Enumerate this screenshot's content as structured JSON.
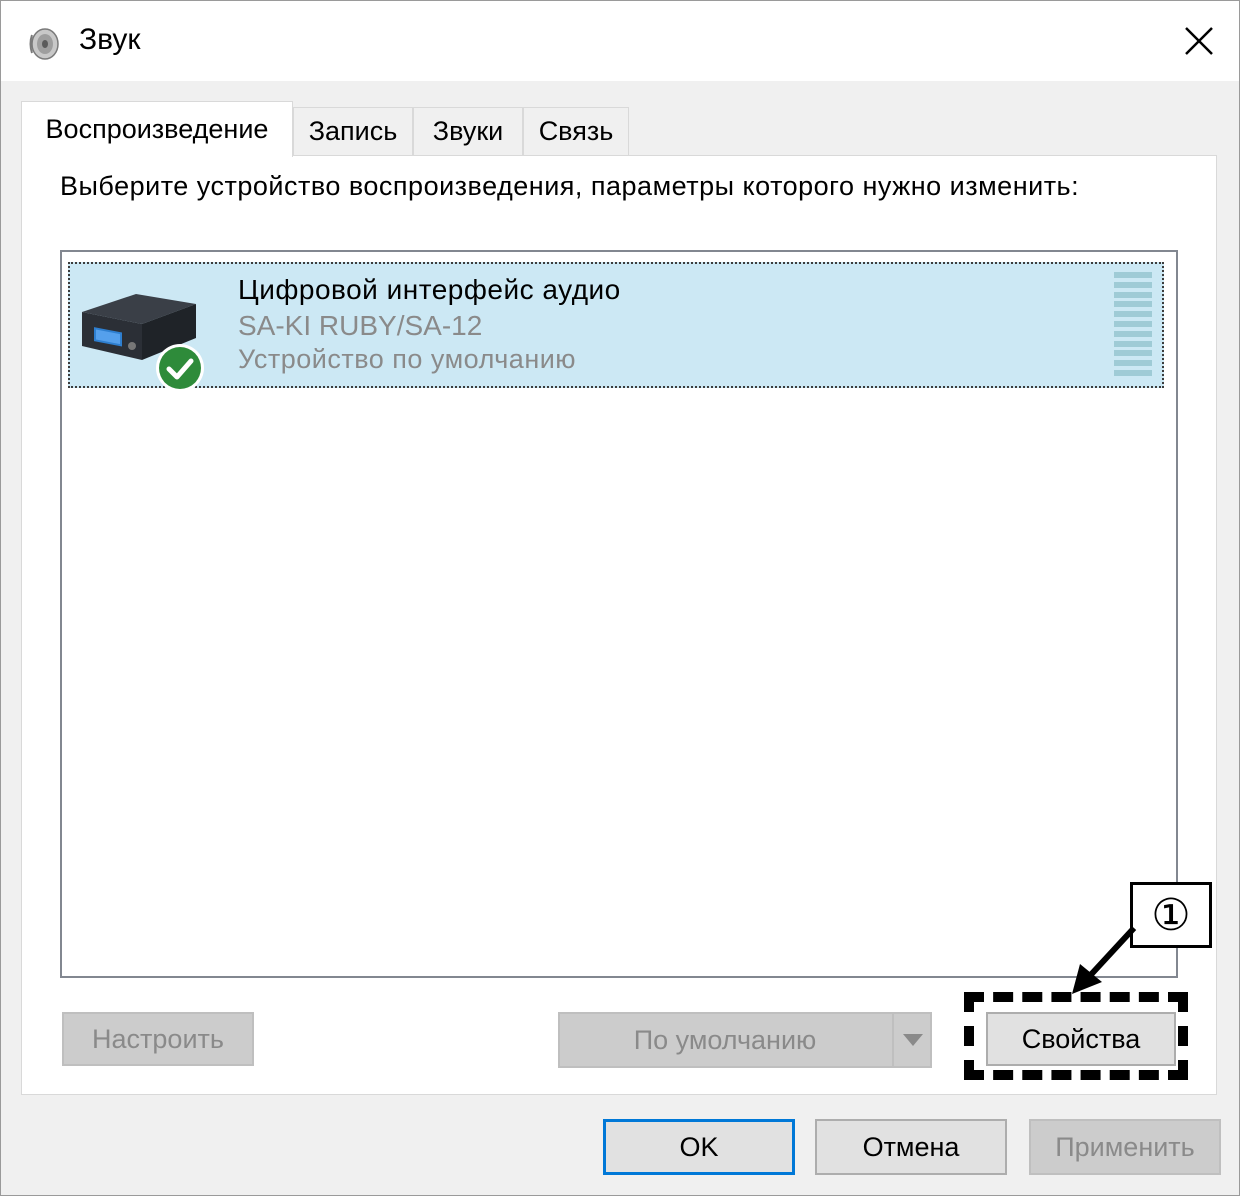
{
  "window": {
    "title": "Звук"
  },
  "tabs": [
    {
      "label": "Воспроизведение",
      "active": true
    },
    {
      "label": "Запись",
      "active": false
    },
    {
      "label": "Звуки",
      "active": false
    },
    {
      "label": "Связь",
      "active": false
    }
  ],
  "panel": {
    "instruction": "Выберите устройство воспроизведения, параметры которого нужно изменить:",
    "devices": [
      {
        "name": "Цифровой интерфейс аудио",
        "model": "SA-KI RUBY/SA-12",
        "status": "Устройство по умолчанию",
        "icon": "audio-interface-icon",
        "badge": "default-checkmark-icon",
        "selected": true
      }
    ],
    "buttons": {
      "configure": "Настроить",
      "set_default": "По умолчанию",
      "properties": "Свойства"
    }
  },
  "footer": {
    "ok": "OK",
    "cancel": "Отмена",
    "apply": "Применить"
  },
  "annotation": {
    "callout_label": "①"
  },
  "colors": {
    "selection": "#cce8f4",
    "default_button_border": "#0078d7",
    "check_badge": "#2e8b3a"
  }
}
